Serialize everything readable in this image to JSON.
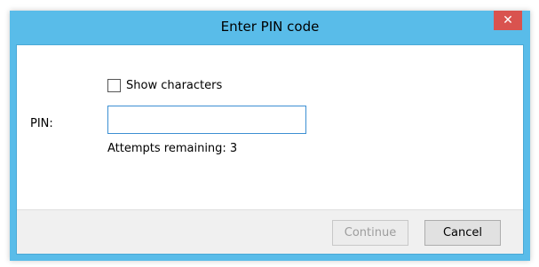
{
  "dialog": {
    "title": "Enter PIN code",
    "close_glyph": "✕",
    "close_icon": "close-icon"
  },
  "form": {
    "show_characters_label": "Show characters",
    "show_characters_checked": false,
    "pin_label": "PIN:",
    "pin_value": "",
    "pin_placeholder": "",
    "attempts_text": "Attempts remaining: 3"
  },
  "buttons": {
    "continue_label": "Continue",
    "continue_enabled": false,
    "cancel_label": "Cancel"
  },
  "colors": {
    "titlebar": "#59bce9",
    "close_button": "#d9534f",
    "input_border": "#3c8fd2"
  }
}
